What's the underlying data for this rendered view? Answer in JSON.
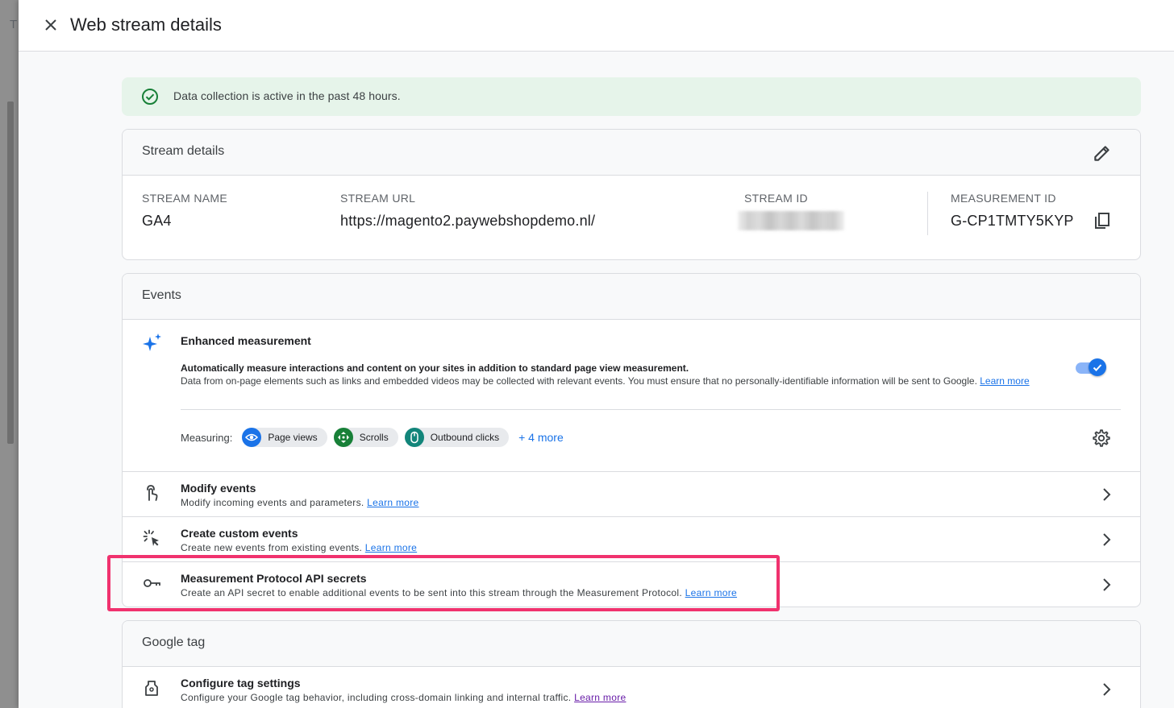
{
  "backdrop": {
    "tab_letter": "T"
  },
  "header": {
    "title": "Web stream details"
  },
  "banner": {
    "text": "Data collection is active in the past 48 hours."
  },
  "stream_details": {
    "title": "Stream details",
    "stream_name_label": "STREAM NAME",
    "stream_name": "GA4",
    "stream_url_label": "STREAM URL",
    "stream_url": "https://magento2.paywebshopdemo.nl/",
    "stream_id_label": "STREAM ID",
    "measurement_id_label": "MEASUREMENT ID",
    "measurement_id": "G-CP1TMTY5KYP"
  },
  "events": {
    "title": "Events",
    "enhanced": {
      "title": "Enhanced measurement",
      "desc1": "Automatically measure interactions and content on your sites in addition to standard page view measurement.",
      "desc2": "Data from on-page elements such as links and embedded videos may be collected with relevant events. You must ensure that no personally-identifiable information will be sent to Google.",
      "learn_more": "Learn more",
      "toggle_on": true,
      "measuring_label": "Measuring:",
      "chips": [
        {
          "label": "Page views",
          "icon": "eye-icon",
          "color": "#1a73e8"
        },
        {
          "label": "Scrolls",
          "icon": "scroll-arrows-icon",
          "color": "#188038"
        },
        {
          "label": "Outbound clicks",
          "icon": "mouse-icon",
          "color": "#12857a"
        }
      ],
      "more": "+ 4 more"
    },
    "rows": [
      {
        "title": "Modify events",
        "desc": "Modify incoming events and parameters.",
        "learn_more": "Learn more"
      },
      {
        "title": "Create custom events",
        "desc": "Create new events from existing events.",
        "learn_more": "Learn more"
      },
      {
        "title": "Measurement Protocol API secrets",
        "desc": "Create an API secret to enable additional events to be sent into this stream through the Measurement Protocol.",
        "learn_more": "Learn more"
      }
    ]
  },
  "google_tag": {
    "title": "Google tag",
    "rows": [
      {
        "title": "Configure tag settings",
        "desc": "Configure your Google tag behavior, including cross-domain linking and internal traffic.",
        "learn_more": "Learn more"
      }
    ]
  },
  "colors": {
    "accent": "#1a73e8",
    "success": "#188038",
    "highlight": "#f0326e"
  }
}
